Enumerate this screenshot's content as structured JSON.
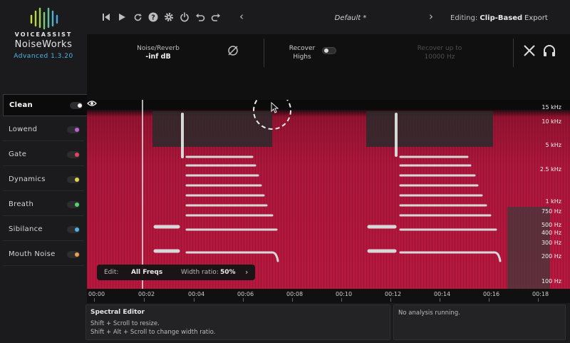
{
  "brand": {
    "small": "VOICEASSIST",
    "main": "NoiseWorks",
    "version": "Advanced 1.3.20",
    "accent": "#4fb3e8"
  },
  "toolbar": {
    "icons": [
      "skip-back-icon",
      "play-icon",
      "loop-icon",
      "help-icon",
      "settings-icon",
      "power-icon",
      "undo-icon",
      "redo-icon"
    ],
    "preset_name": "Default *",
    "editing_label": "Editing:",
    "editing_value": "Clip-Based",
    "export_label": "Export"
  },
  "module_header": {
    "noise_reverb_label": "Noise/Reverb",
    "noise_reverb_value": "-inf dB",
    "recover_highs_line1": "Recover",
    "recover_highs_line2": "Highs",
    "recover_highs_on": false,
    "recover_upto_line1": "Recover up to",
    "recover_upto_line2": "10000 Hz"
  },
  "modules": [
    {
      "label": "Clean",
      "color": "#f2f2f2",
      "active": true
    },
    {
      "label": "Lowend",
      "color": "#c160d6",
      "active": false
    },
    {
      "label": "Gate",
      "color": "#e0455a",
      "active": false
    },
    {
      "label": "Dynamics",
      "color": "#e6d34a",
      "active": false
    },
    {
      "label": "Breath",
      "color": "#4fd66a",
      "active": false
    },
    {
      "label": "Sibilance",
      "color": "#4fb3e8",
      "active": false
    },
    {
      "label": "Mouth Noise",
      "color": "#e8a14f",
      "active": false
    }
  ],
  "spectrogram": {
    "freq_labels": [
      "15 kHz",
      "10 kHz",
      "5 kHz",
      "2.5 kHz",
      "1 kHz",
      "750 Hz",
      "500 Hz",
      "400 Hz",
      "300 Hz",
      "200 Hz",
      "100 Hz"
    ],
    "base_color": "#b3163a",
    "playhead_time": "00:02"
  },
  "edit_bar": {
    "edit_label": "Edit:",
    "edit_value": "All Freqs",
    "width_label": "Width ratio:",
    "width_value": "50%"
  },
  "timeline": {
    "labels": [
      "00:00",
      "00:02",
      "00:04",
      "00:06",
      "00:08",
      "00:10",
      "00:12",
      "00:14",
      "00:16",
      "00:18"
    ]
  },
  "spectral_editor": {
    "title": "Spectral Editor",
    "line1": "Shift + Scroll to resize.",
    "line2": "Shift + Alt + Scroll to change width ratio."
  },
  "analysis": {
    "status": "No analysis running."
  }
}
